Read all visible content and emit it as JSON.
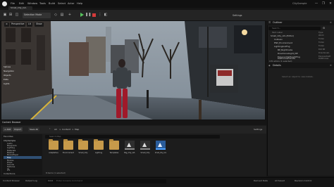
{
  "menu": [
    "File",
    "Edit",
    "Window",
    "Tools",
    "Build",
    "Select",
    "Actor",
    "Help"
  ],
  "project_tab": "Small_City_LVL",
  "window_title": "CitySample",
  "window_controls": [
    "—",
    "❐",
    "✕"
  ],
  "toolbar": {
    "modes_label": "Selection Mode",
    "settings_label": "Settings"
  },
  "viewport": {
    "chips": [
      "Perspective",
      "Lit",
      "Show"
    ],
    "side_items": [
      "Splines",
      "Navigation",
      "Objects",
      "Edits",
      "Lights"
    ]
  },
  "outliner": {
    "title": "Outliner",
    "search_placeholder": "Search...",
    "columns": [
      "Item Label",
      "Type"
    ],
    "rows": [
      {
        "label": "Small_City_LVL (Editor)",
        "type": "World",
        "depth": 0
      },
      {
        "label": "Collision",
        "type": "Folder",
        "depth": 1
      },
      {
        "label": "ENV_Environment",
        "type": "Folder",
        "depth": 1
      },
      {
        "label": "LightingAndFog",
        "type": "Folder",
        "depth": 1
      },
      {
        "label": "BP_Nightmode",
        "type": "Edit BP",
        "depth": 2
      },
      {
        "label": "DirectionalLight_MP",
        "type": "DirectionalL",
        "depth": 2
      },
      {
        "label": "ExponentialHeightFog",
        "type": "ExponentialH",
        "depth": 2
      },
      {
        "label": "PostProcessVolume",
        "type": "PostProcess",
        "depth": 2
      }
    ],
    "footer": "170 actors (1 selected)"
  },
  "details": {
    "title": "Details",
    "empty_text": "Select an object to view details."
  },
  "content_browser": {
    "tab": "Content Browser",
    "add_label": "+ Add",
    "import_label": "Import",
    "save_label": "Save All",
    "breadcrumbs": [
      "All",
      ">",
      "Content",
      ">",
      "Map"
    ],
    "settings_label": "Settings",
    "favorites_label": "Favorites",
    "project_label": "CitySample",
    "tree": [
      "Audio",
      "Blueprints",
      "Lighting",
      "Map",
      "Materials",
      "Meshes",
      "MoviePlayer",
      "Movies",
      "Props",
      "Sounds",
      "Textures",
      "UI",
      "VFX"
    ],
    "selected_tree": "Map",
    "collections_label": "Collections",
    "filter_placeholder": "Search Map",
    "assets": [
      {
        "label": "Adaptative",
        "kind": "folder"
      },
      {
        "label": "Environment",
        "kind": "folder"
      },
      {
        "label": "Small_City",
        "kind": "folder"
      },
      {
        "label": "Lighting",
        "kind": "folder"
      },
      {
        "label": "Templates",
        "kind": "folder"
      },
      {
        "label": "Big_City_LVL",
        "kind": "level"
      },
      {
        "label": "Small_City",
        "kind": "level"
      },
      {
        "label": "Small_City_LVL",
        "kind": "level-selected"
      }
    ],
    "count": "8 items (1 selected)"
  },
  "statusbar": {
    "drawer": "Content Drawer",
    "output_log": "Output Log",
    "cmd": "Cmd",
    "cmd_placeholder": "Enter Console Command",
    "derived": "Derived Data",
    "save": "All Saved",
    "revision": "Revision Control"
  },
  "colors": {
    "accent": "#2a5c9a",
    "play": "#56c25c",
    "stop": "#d43a3a",
    "folder": "#c79a4a"
  }
}
